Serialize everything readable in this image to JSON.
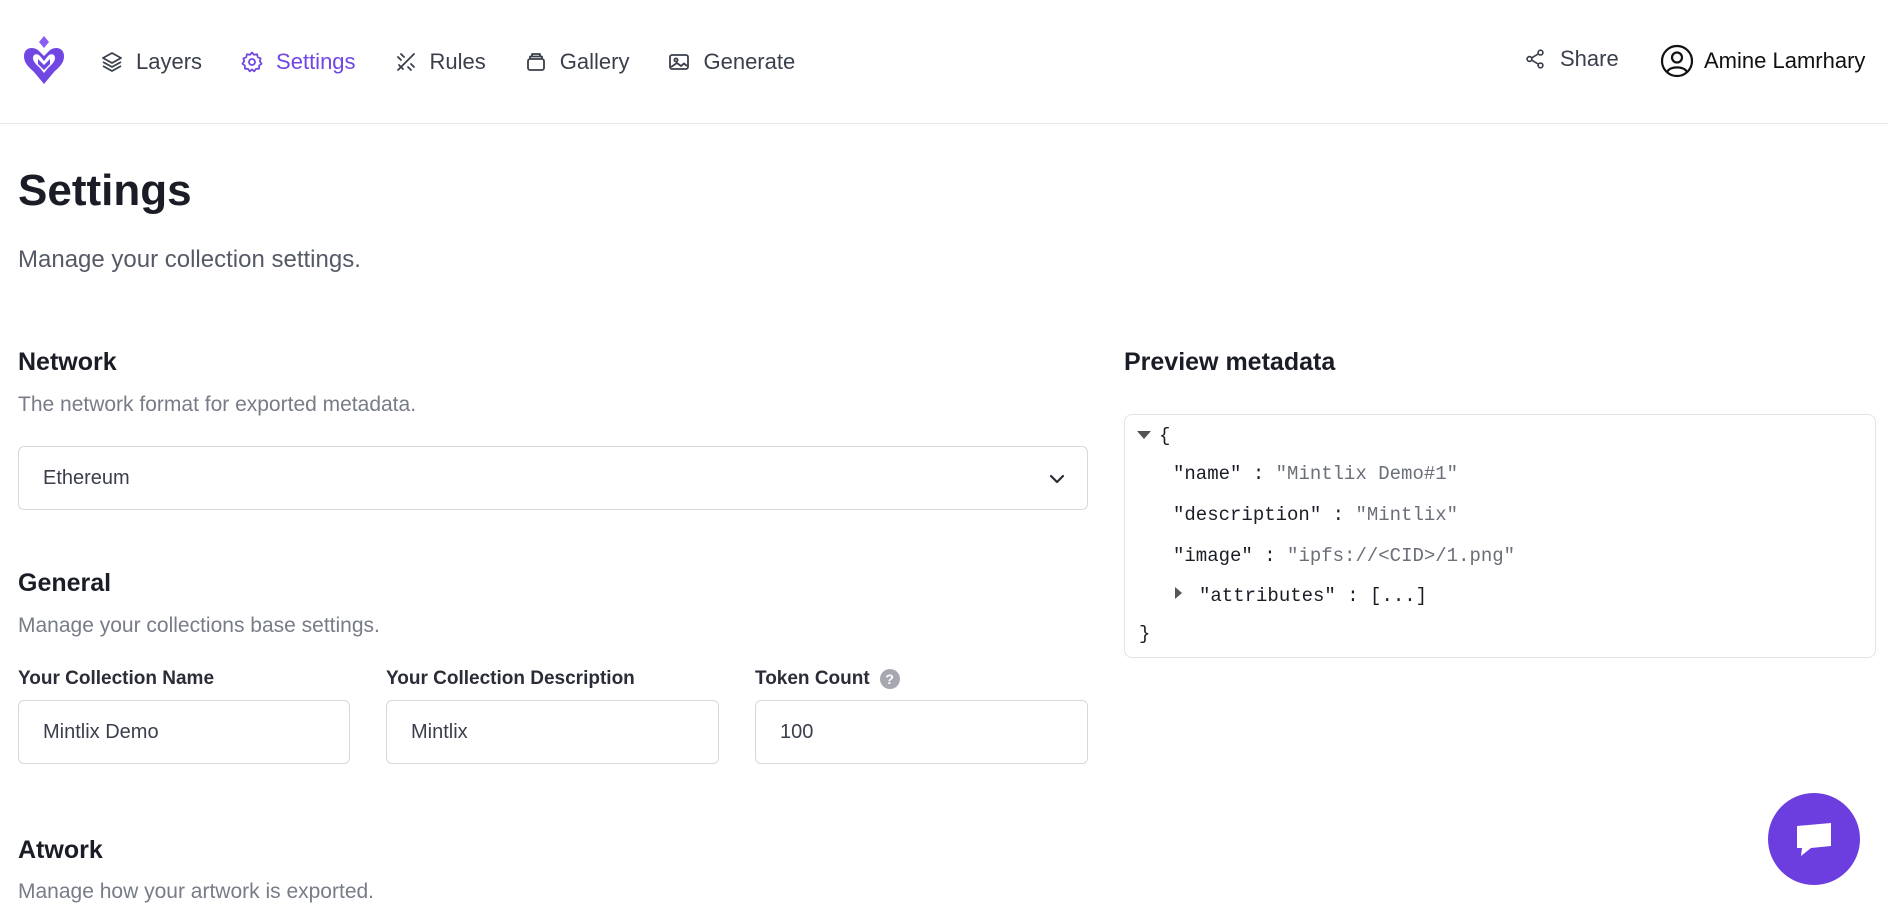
{
  "nav": {
    "items": [
      {
        "label": "Layers",
        "icon": "layers-icon",
        "active": false
      },
      {
        "label": "Settings",
        "icon": "gear-icon",
        "active": true
      },
      {
        "label": "Rules",
        "icon": "rules-icon",
        "active": false
      },
      {
        "label": "Gallery",
        "icon": "gallery-icon",
        "active": false
      },
      {
        "label": "Generate",
        "icon": "image-icon",
        "active": false
      }
    ],
    "share_label": "Share",
    "user_name": "Amine Lamrhary"
  },
  "page": {
    "title": "Settings",
    "subtitle": "Manage your collection settings."
  },
  "network": {
    "title": "Network",
    "description": "The network format for exported metadata.",
    "selected": "Ethereum"
  },
  "general": {
    "title": "General",
    "description": "Manage your collections base settings.",
    "name_label": "Your Collection Name",
    "name_value": "Mintlix Demo",
    "desc_label": "Your Collection Description",
    "desc_value": "Mintlix",
    "count_label": "Token Count",
    "count_help": "?",
    "count_value": "100"
  },
  "artwork": {
    "title": "Atwork",
    "description": "Manage how your artwork is exported."
  },
  "preview": {
    "title": "Preview metadata",
    "open_brace": "{",
    "close_brace": "}",
    "name_key": "\"name\"",
    "name_val": "\"Mintlix Demo#1\"",
    "description_key": "\"description\"",
    "description_val": "\"Mintlix\"",
    "image_key": "\"image\"",
    "image_val": "\"ipfs://<CID>/1.png\"",
    "attributes_key": "\"attributes\"",
    "attributes_val": "[...]",
    "separator": ":"
  },
  "colors": {
    "accent": "#7047e3",
    "chat_button": "#6c3ee0"
  }
}
